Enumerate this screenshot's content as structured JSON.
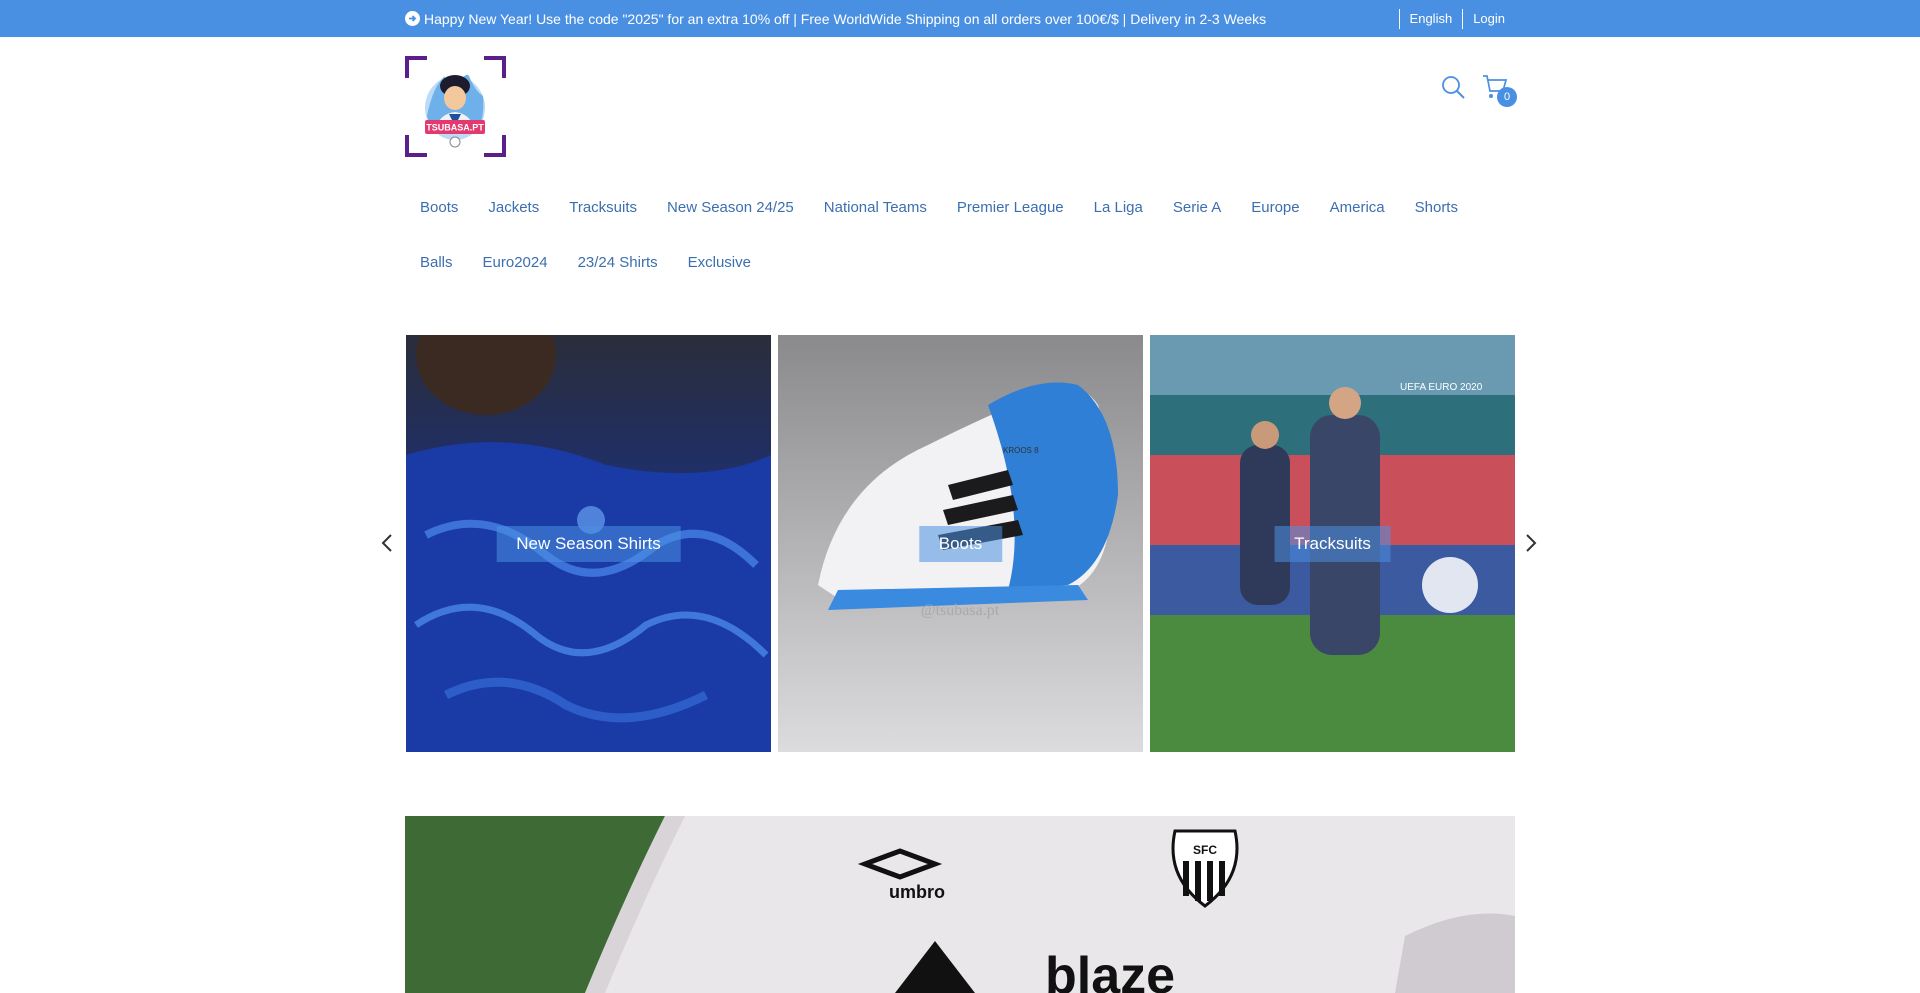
{
  "announcement": {
    "text": "Happy New Year! Use the code \"2025\" for an extra 10% off | Free WorldWide Shipping on all orders over 100€/$ | Delivery in 2-3 Weeks",
    "icon": "arrow-circle-right-icon"
  },
  "topbar": {
    "language": "English",
    "login": "Login"
  },
  "header": {
    "logo_text": "TSUBASA.PT",
    "cart_count": "0"
  },
  "nav": {
    "row1": [
      "Boots",
      "Jackets",
      "Tracksuits",
      "New Season 24/25",
      "National Teams",
      "Premier League",
      "La Liga",
      "Serie A",
      "Europe",
      "America",
      "Shorts"
    ],
    "row2": [
      "Balls",
      "Euro2024",
      "23/24 Shirts",
      "Exclusive"
    ]
  },
  "carousel": {
    "tiles": [
      {
        "caption": "New Season Shirts"
      },
      {
        "caption": "Boots",
        "watermark": "@tsubasa.pt",
        "boot_text": "KROOS 8"
      },
      {
        "caption": "Tracksuits",
        "stadium_text": "UEFA EURO 2020"
      }
    ]
  },
  "banner": {
    "brand1": "umbro",
    "crest": "SFC",
    "sponsor": "blaze"
  },
  "colors": {
    "accent": "#4a90e2",
    "nav_text": "#3c6fb0"
  }
}
